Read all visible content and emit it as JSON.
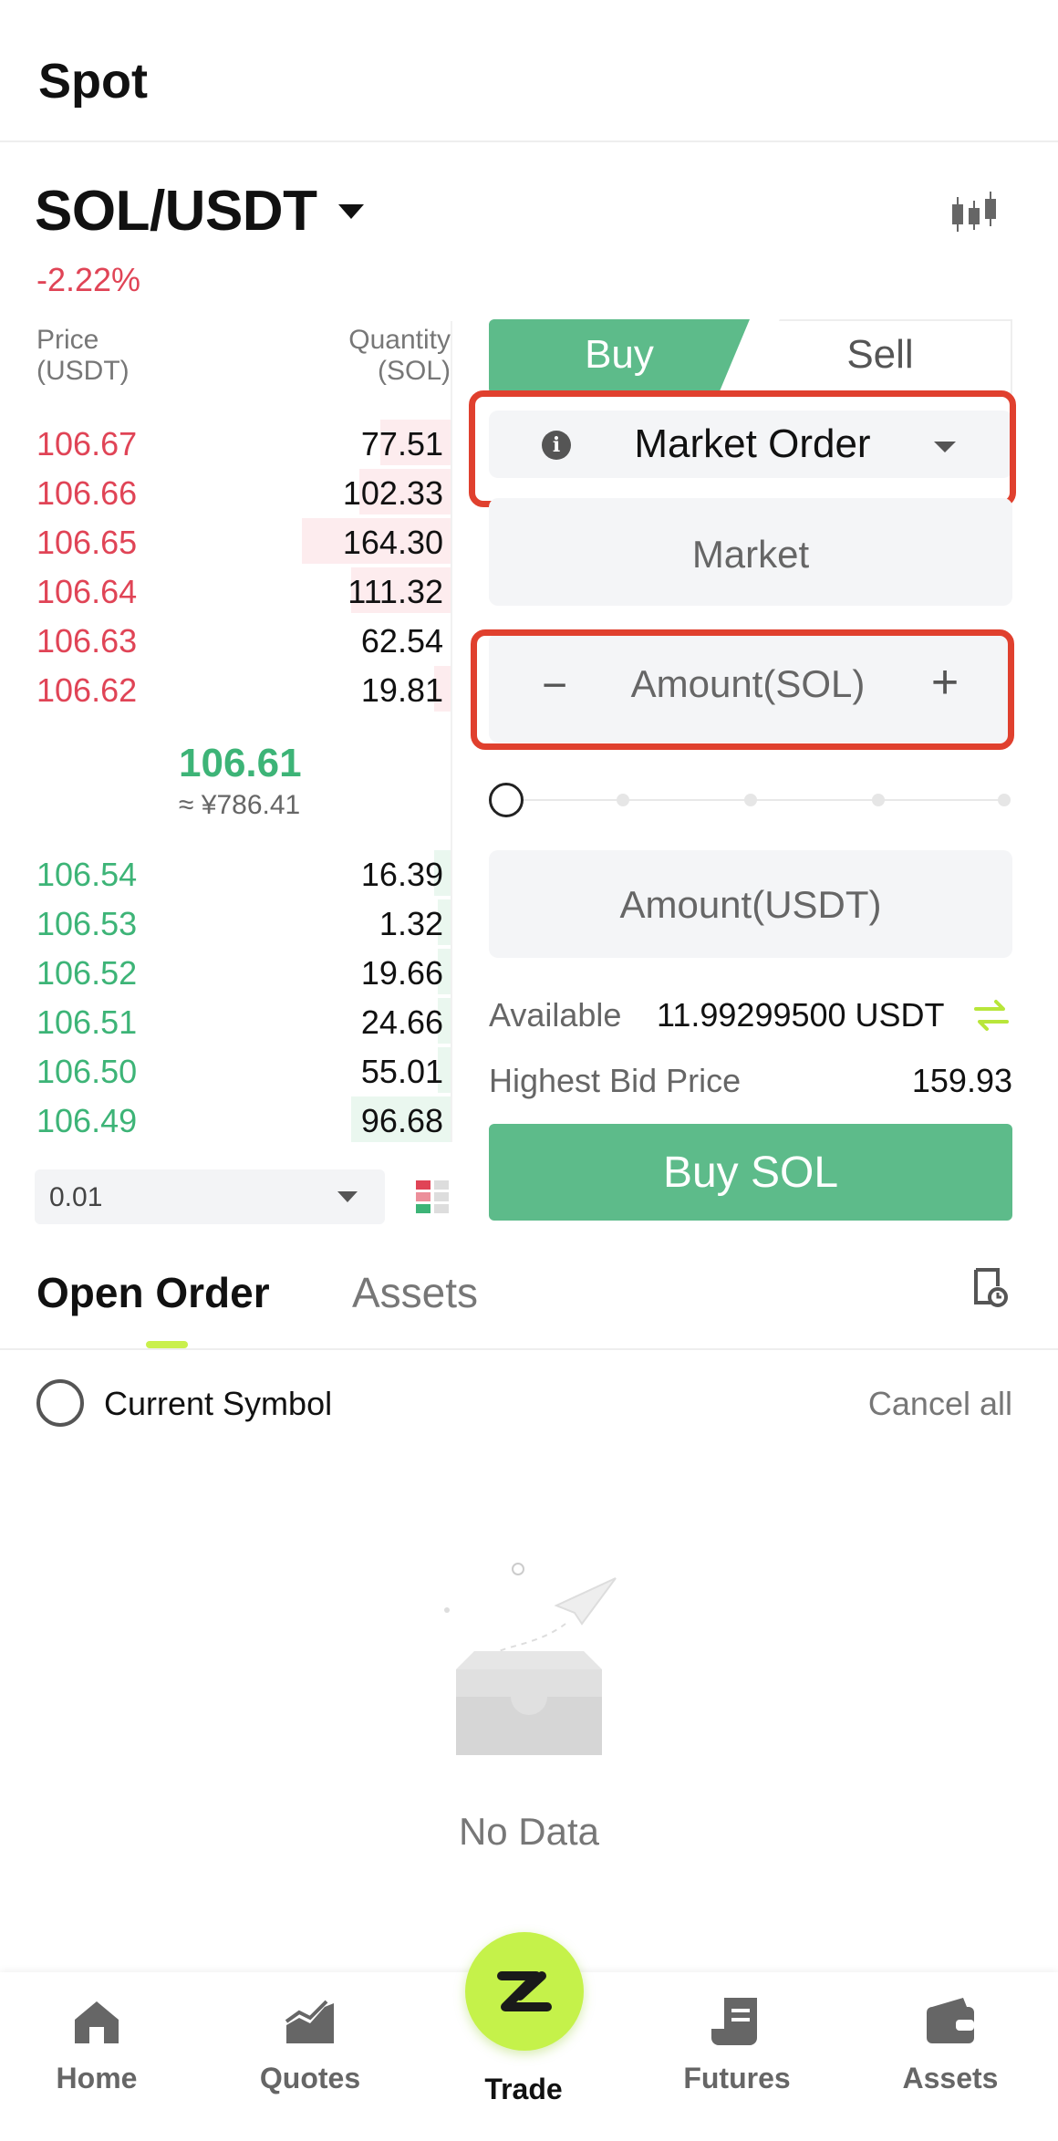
{
  "header": {
    "title": "Spot"
  },
  "pair": {
    "name": "SOL/USDT",
    "change": "-2.22%"
  },
  "order_book": {
    "price_header": [
      "Price",
      "(USDT)"
    ],
    "qty_header": [
      "Quantity",
      "(SOL)"
    ],
    "asks": [
      {
        "price": "106.67",
        "qty": "77.51",
        "depth": 0.17
      },
      {
        "price": "106.66",
        "qty": "102.33",
        "depth": 0.22
      },
      {
        "price": "106.65",
        "qty": "164.30",
        "depth": 0.36
      },
      {
        "price": "106.64",
        "qty": "111.32",
        "depth": 0.24
      },
      {
        "price": "106.63",
        "qty": "62.54",
        "depth": 0.0
      },
      {
        "price": "106.62",
        "qty": "19.81",
        "depth": 0.04
      }
    ],
    "last_price": "106.61",
    "last_price_cny": "≈ ¥786.41",
    "bids": [
      {
        "price": "106.54",
        "qty": "16.39",
        "depth": 0.04
      },
      {
        "price": "106.53",
        "qty": "1.32",
        "depth": 0.03
      },
      {
        "price": "106.52",
        "qty": "19.66",
        "depth": 0.03
      },
      {
        "price": "106.51",
        "qty": "24.66",
        "depth": 0.03
      },
      {
        "price": "106.50",
        "qty": "55.01",
        "depth": 0.03
      },
      {
        "price": "106.49",
        "qty": "96.68",
        "depth": 0.24
      }
    ],
    "depth_precision": "0.01"
  },
  "trade_form": {
    "buy_tab": "Buy",
    "sell_tab": "Sell",
    "order_type": "Market Order",
    "price_mode": "Market",
    "amount_placeholder": "Amount(SOL)",
    "amount_usdt_placeholder": "Amount(USDT)",
    "slider_percent": 0,
    "available_label": "Available",
    "available_value": "11.99299500 USDT",
    "highest_bid_label": "Highest Bid Price",
    "highest_bid_value": "159.93",
    "buy_button": "Buy SOL",
    "buy_color": "#5dbb8a",
    "highlight_color": "#e0402e"
  },
  "orders": {
    "tab_open": "Open Order",
    "tab_assets": "Assets",
    "current_symbol": "Current Symbol",
    "cancel_all": "Cancel all",
    "empty_text": "No Data"
  },
  "nav": {
    "items": [
      {
        "label": "Home",
        "icon": "home-icon"
      },
      {
        "label": "Quotes",
        "icon": "chart-icon"
      },
      {
        "label": "Trade",
        "icon": "trade-logo-icon"
      },
      {
        "label": "Futures",
        "icon": "futures-icon"
      },
      {
        "label": "Assets",
        "icon": "wallet-icon"
      }
    ],
    "active": "Trade",
    "accent": "#c5f24a"
  }
}
